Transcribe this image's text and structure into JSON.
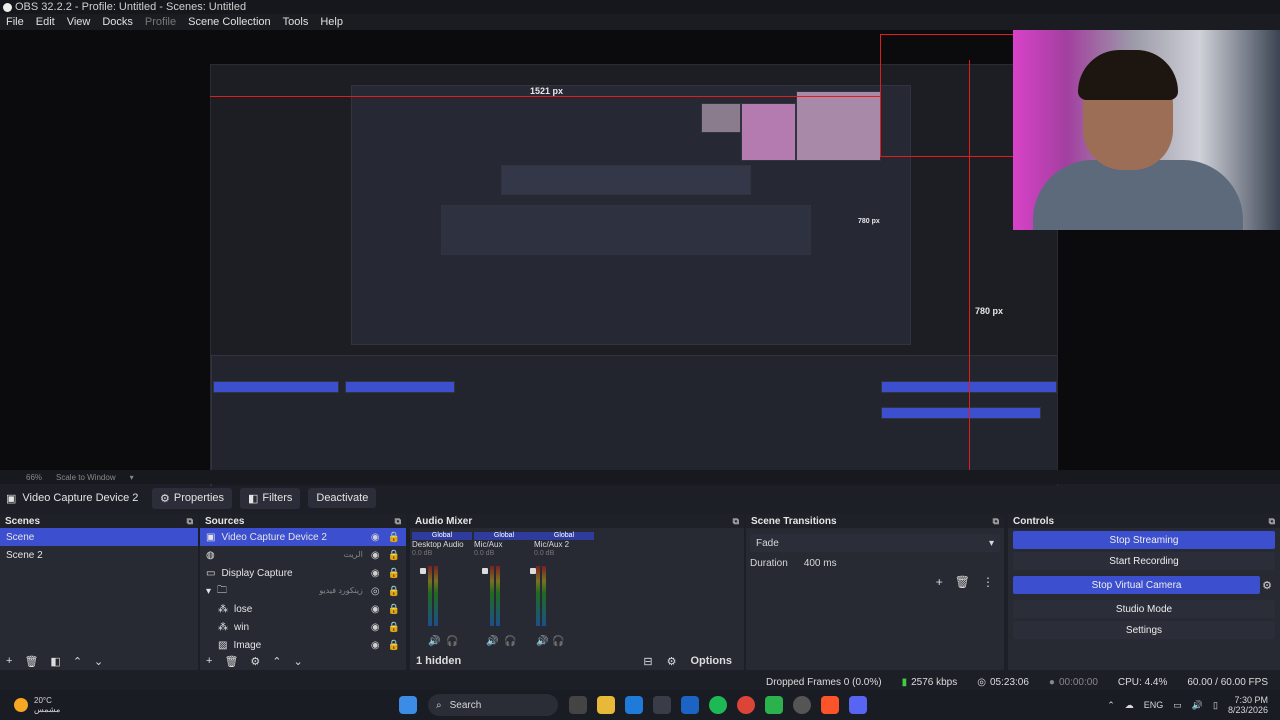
{
  "window": {
    "title": "OBS 32.2.2 - Profile: Untitled - Scenes: Untitled"
  },
  "menu": [
    "File",
    "Edit",
    "View",
    "Docks",
    "Profile",
    "Scene Collection",
    "Tools",
    "Help"
  ],
  "preview": {
    "measure_top": "1521 px",
    "measure_mid": "780 px",
    "measure_side": "780 px"
  },
  "zoom": {
    "level": "66%",
    "scale": "Scale to Window"
  },
  "source_bar": {
    "source_name": "Video Capture Device 2",
    "properties": "Properties",
    "filters": "Filters",
    "deactivate": "Deactivate"
  },
  "scenes": {
    "title": "Scenes",
    "items": [
      "Scene",
      "Scene 2"
    ]
  },
  "sources": {
    "title": "Sources",
    "items": [
      {
        "label": "Video Capture Device 2",
        "icon": "camera-icon"
      },
      {
        "label": "",
        "sublabel": "الريت",
        "icon": "browser-icon"
      },
      {
        "label": "Display Capture",
        "icon": "monitor-icon"
      },
      {
        "label": "",
        "sublabel": "زينكورد فيديو",
        "icon": "folder-icon"
      },
      {
        "label": "lose",
        "icon": "media-icon"
      },
      {
        "label": "win",
        "icon": "media-icon"
      },
      {
        "label": "Image",
        "icon": "image-icon"
      }
    ]
  },
  "mixer": {
    "title": "Audio Mixer",
    "channels": [
      {
        "name": "Desktop Audio",
        "badge": "Global",
        "db": "0.0 dB"
      },
      {
        "name": "Mic/Aux",
        "badge": "Global",
        "db": "0.0 dB"
      },
      {
        "name": "Mic/Aux 2",
        "badge": "Global",
        "db": "0.0 dB"
      }
    ],
    "hidden": "1 hidden",
    "options": "Options"
  },
  "transitions": {
    "title": "Scene Transitions",
    "type": "Fade",
    "duration_label": "Duration",
    "duration_value": "400 ms"
  },
  "controls": {
    "title": "Controls",
    "buttons": [
      "Stop Streaming",
      "Start Recording",
      "Stop Virtual Camera",
      "Studio Mode",
      "Settings"
    ]
  },
  "status": {
    "dropped": "Dropped Frames 0 (0.0%)",
    "bitrate": "2576 kbps",
    "stream_time": "05:23:06",
    "rec_time": "00:00:00",
    "cpu": "CPU: 4.4%",
    "fps": "60.00 / 60.00 FPS"
  },
  "taskbar": {
    "temp": "20°C",
    "weather": "مشمس",
    "search": "Search",
    "lang": "ENG",
    "time": "7:30 PM",
    "date": "8/23/2026"
  },
  "colors": {
    "accent": "#3c4fcf",
    "bg": "#1d1f26",
    "panel": "#272a33"
  }
}
